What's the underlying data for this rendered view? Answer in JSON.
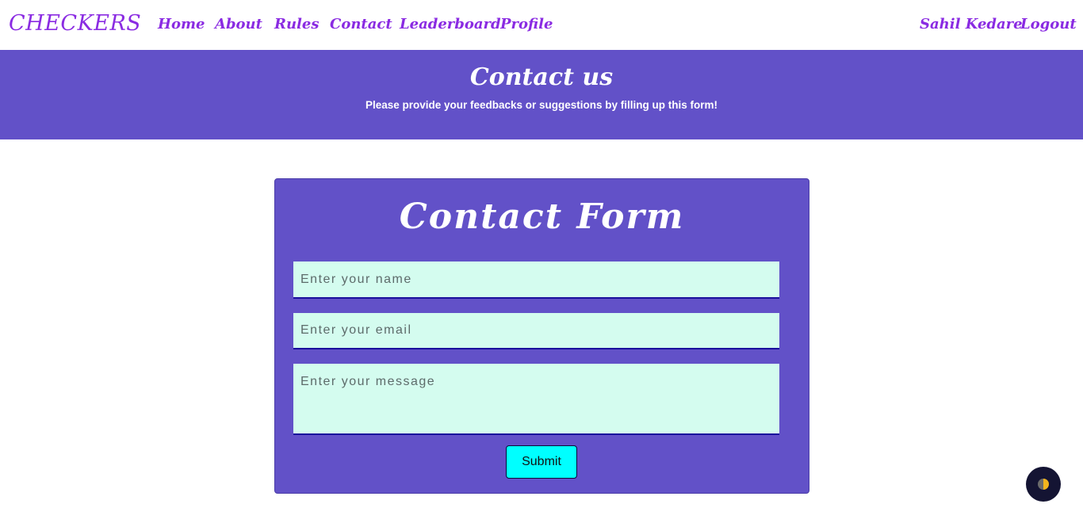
{
  "brand": "CHECKERS",
  "nav": {
    "home": "Home",
    "about": "About",
    "rules": "Rules",
    "contact": "Contact",
    "leaderboard": "Leaderboard",
    "profile": "Profile",
    "user": "Sahil Kedare",
    "logout": "Logout"
  },
  "hero": {
    "title": "Contact us",
    "subtitle": "Please provide your feedbacks or suggestions by filling up this form!"
  },
  "form": {
    "title": "Contact Form",
    "name_placeholder": "Enter your name",
    "email_placeholder": "Enter your email",
    "message_placeholder": "Enter your message",
    "submit_label": "Submit"
  },
  "colors": {
    "accent": "#8a2be2",
    "panel": "#6251c8",
    "field": "#d4fcef",
    "submit": "#00ffff"
  },
  "theme_toggle": {
    "icon": "half-circle-icon"
  }
}
